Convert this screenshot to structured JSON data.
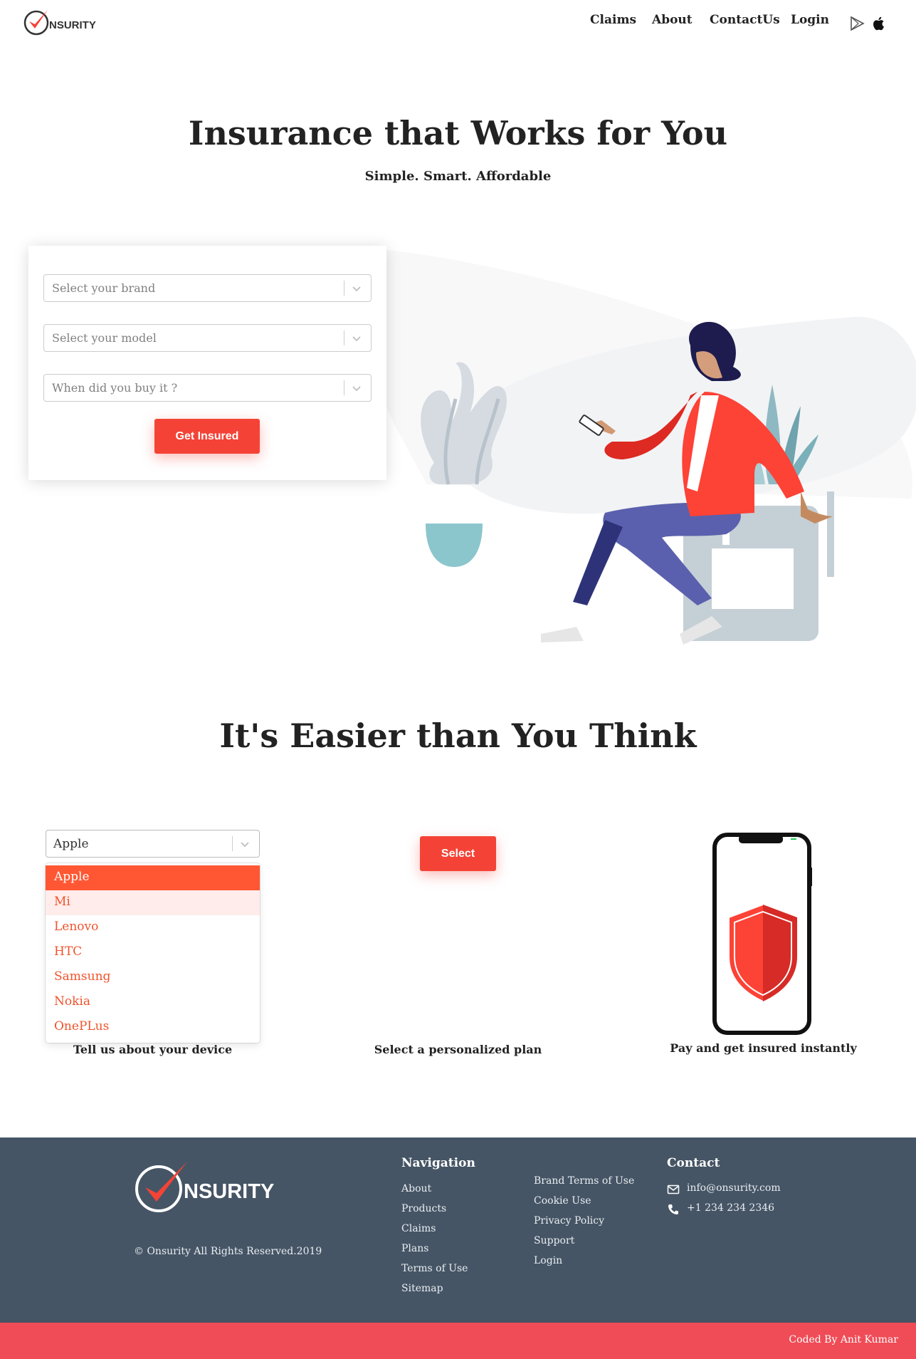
{
  "header": {
    "logo_text": "NSURITY",
    "nav": [
      "Claims",
      "About",
      "ContactUs",
      "Login"
    ],
    "icons": [
      "play-store-icon",
      "apple-icon"
    ]
  },
  "hero": {
    "title": "Insurance that Works for You",
    "subtitle": "Simple. Smart. Affordable",
    "form": {
      "brand_placeholder": "Select your brand",
      "model_placeholder": "Select your model",
      "date_placeholder": "When did you buy it ?",
      "submit_label": "Get Insured"
    }
  },
  "steps": {
    "title": "It's Easier than You Think",
    "brand_select": {
      "value": "Apple",
      "options": [
        "Apple",
        "Mi",
        "Lenovo",
        "HTC",
        "Samsung",
        "Nokia",
        "OnePLus"
      ]
    },
    "select_button": "Select",
    "captions": [
      "Tell us about your device",
      "Select a personalized plan",
      "Pay and get insured instantly"
    ]
  },
  "footer": {
    "logo_text": "NSURITY",
    "copyright": "© Onsurity  All Rights Reserved.2019",
    "navigation_heading": "Navigation",
    "nav_links": [
      "About",
      "Products",
      "Claims",
      "Plans",
      "Terms of Use",
      "Sitemap"
    ],
    "more_links": [
      "Brand Terms of Use",
      "Cookie Use",
      "Privacy Policy",
      "Support",
      "Login"
    ],
    "contact_heading": "Contact",
    "email": "info@onsurity.com",
    "phone": "+1 234 234 2346"
  },
  "bottom_bar": {
    "credit": "Coded By Anit Kumar"
  },
  "colors": {
    "accent": "#f44336",
    "dropdown_active": "#ff5733",
    "footer_bg": "#465565",
    "bottom_bar": "#ef4c57"
  }
}
